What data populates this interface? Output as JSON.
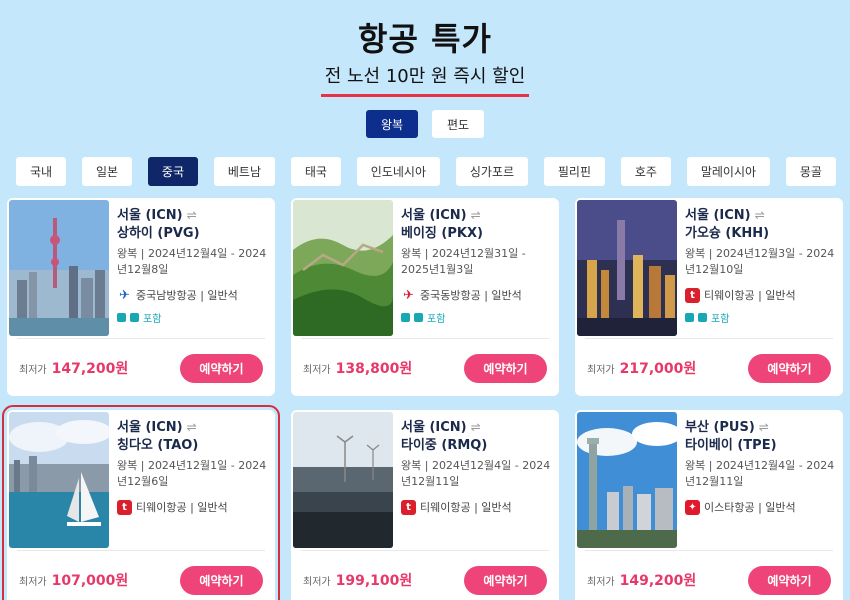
{
  "header": {
    "title": "항공 특가",
    "subtitle": "전 노선 10만 원 즉시 할인"
  },
  "trip_types": [
    {
      "label": "왕복",
      "active": true
    },
    {
      "label": "편도",
      "active": false
    }
  ],
  "countries": [
    "국내",
    "일본",
    "중국",
    "베트남",
    "태국",
    "인도네시아",
    "싱가포르",
    "필리핀",
    "호주",
    "말레이시아",
    "몽골"
  ],
  "active_country": "중국",
  "price_prefix": "최저가",
  "book_label": "예약하기",
  "baggage_label": "포함",
  "colors": {
    "accent_pink": "#ee4479",
    "navy": "#0f2668",
    "underline_red": "#e53245",
    "page_bg": "#c5e7fb"
  },
  "deals": [
    {
      "origin": "서울 (ICN)",
      "dest": "상하이 (PVG)",
      "dates": "왕복 | 2024년12월4일 - 2024년12월8일",
      "airline": "중국남방항공 | 일반석",
      "airline_icon": "china-southern-logo",
      "baggage": true,
      "price": "147,200원"
    },
    {
      "origin": "서울 (ICN)",
      "dest": "베이징 (PKX)",
      "dates": "왕복 | 2024년12월31일 - 2025년1월3일",
      "airline": "중국동방항공 | 일반석",
      "airline_icon": "china-eastern-logo",
      "baggage": true,
      "price": "138,800원"
    },
    {
      "origin": "서울 (ICN)",
      "dest": "가오슝 (KHH)",
      "dates": "왕복 | 2024년12월3일 - 2024년12월10일",
      "airline": "티웨이항공 | 일반석",
      "airline_icon": "tway-logo",
      "baggage": true,
      "price": "217,000원"
    },
    {
      "origin": "서울 (ICN)",
      "dest": "칭다오 (TAO)",
      "dates": "왕복 | 2024년12월1일 - 2024년12월6일",
      "airline": "티웨이항공 | 일반석",
      "airline_icon": "tway-logo",
      "baggage": false,
      "price": "107,000원"
    },
    {
      "origin": "서울 (ICN)",
      "dest": "타이중 (RMQ)",
      "dates": "왕복 | 2024년12월4일 - 2024년12월11일",
      "airline": "티웨이항공 | 일반석",
      "airline_icon": "tway-logo",
      "baggage": false,
      "price": "199,100원"
    },
    {
      "origin": "부산 (PUS)",
      "dest": "타이베이 (TPE)",
      "dates": "왕복 | 2024년12월4일 - 2024년12월11일",
      "airline": "이스타항공 | 일반석",
      "airline_icon": "eastar-logo",
      "baggage": false,
      "price": "149,200원"
    }
  ]
}
